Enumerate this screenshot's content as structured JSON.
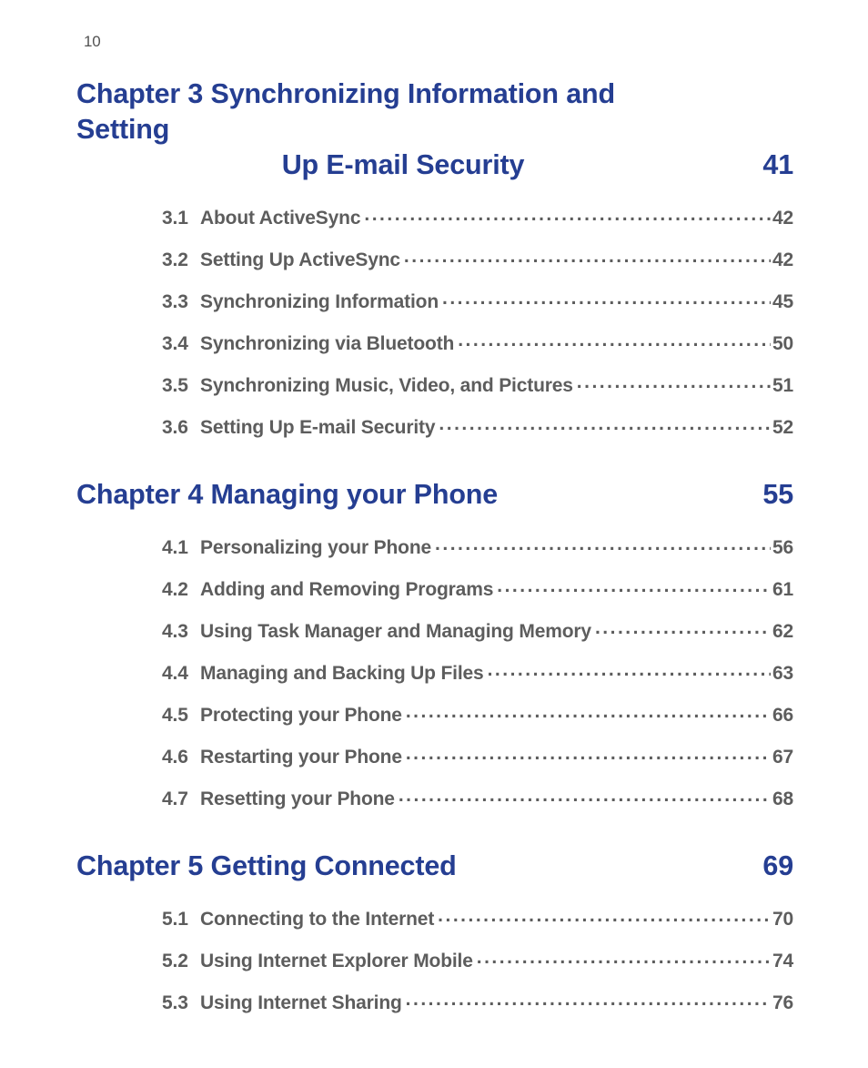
{
  "page_number": "10",
  "chapters": [
    {
      "title_line1": "Chapter 3 Synchronizing Information and Setting",
      "title_line2": "Up E-mail Security",
      "multiline": true,
      "page": "41",
      "entries": [
        {
          "num": "3.1",
          "title": "About ActiveSync",
          "page": "42"
        },
        {
          "num": "3.2",
          "title": "Setting Up ActiveSync",
          "page": "42"
        },
        {
          "num": "3.3",
          "title": "Synchronizing Information",
          "page": "45"
        },
        {
          "num": "3.4",
          "title": "Synchronizing via Bluetooth",
          "page": "50"
        },
        {
          "num": "3.5",
          "title": "Synchronizing Music, Video, and Pictures",
          "page": "51"
        },
        {
          "num": "3.6",
          "title": "Setting Up E-mail Security",
          "page": "52"
        }
      ]
    },
    {
      "title_line1": "Chapter 4 Managing your Phone",
      "multiline": false,
      "page": "55",
      "entries": [
        {
          "num": "4.1",
          "title": "Personalizing your Phone",
          "page": "56"
        },
        {
          "num": "4.2",
          "title": "Adding and Removing Programs",
          "page": "61"
        },
        {
          "num": "4.3",
          "title": "Using Task Manager and Managing Memory",
          "page": "62"
        },
        {
          "num": "4.4",
          "title": "Managing and Backing Up Files",
          "page": "63"
        },
        {
          "num": "4.5",
          "title": "Protecting your Phone",
          "page": "66"
        },
        {
          "num": "4.6",
          "title": "Restarting your Phone",
          "page": "67"
        },
        {
          "num": "4.7",
          "title": "Resetting your Phone",
          "page": "68"
        }
      ]
    },
    {
      "title_line1": "Chapter 5 Getting Connected",
      "multiline": false,
      "page": "69",
      "entries": [
        {
          "num": "5.1",
          "title": "Connecting to the Internet",
          "page": "70"
        },
        {
          "num": "5.2",
          "title": "Using Internet Explorer Mobile",
          "page": "74"
        },
        {
          "num": "5.3",
          "title": "Using Internet Sharing",
          "page": "76"
        }
      ]
    }
  ]
}
